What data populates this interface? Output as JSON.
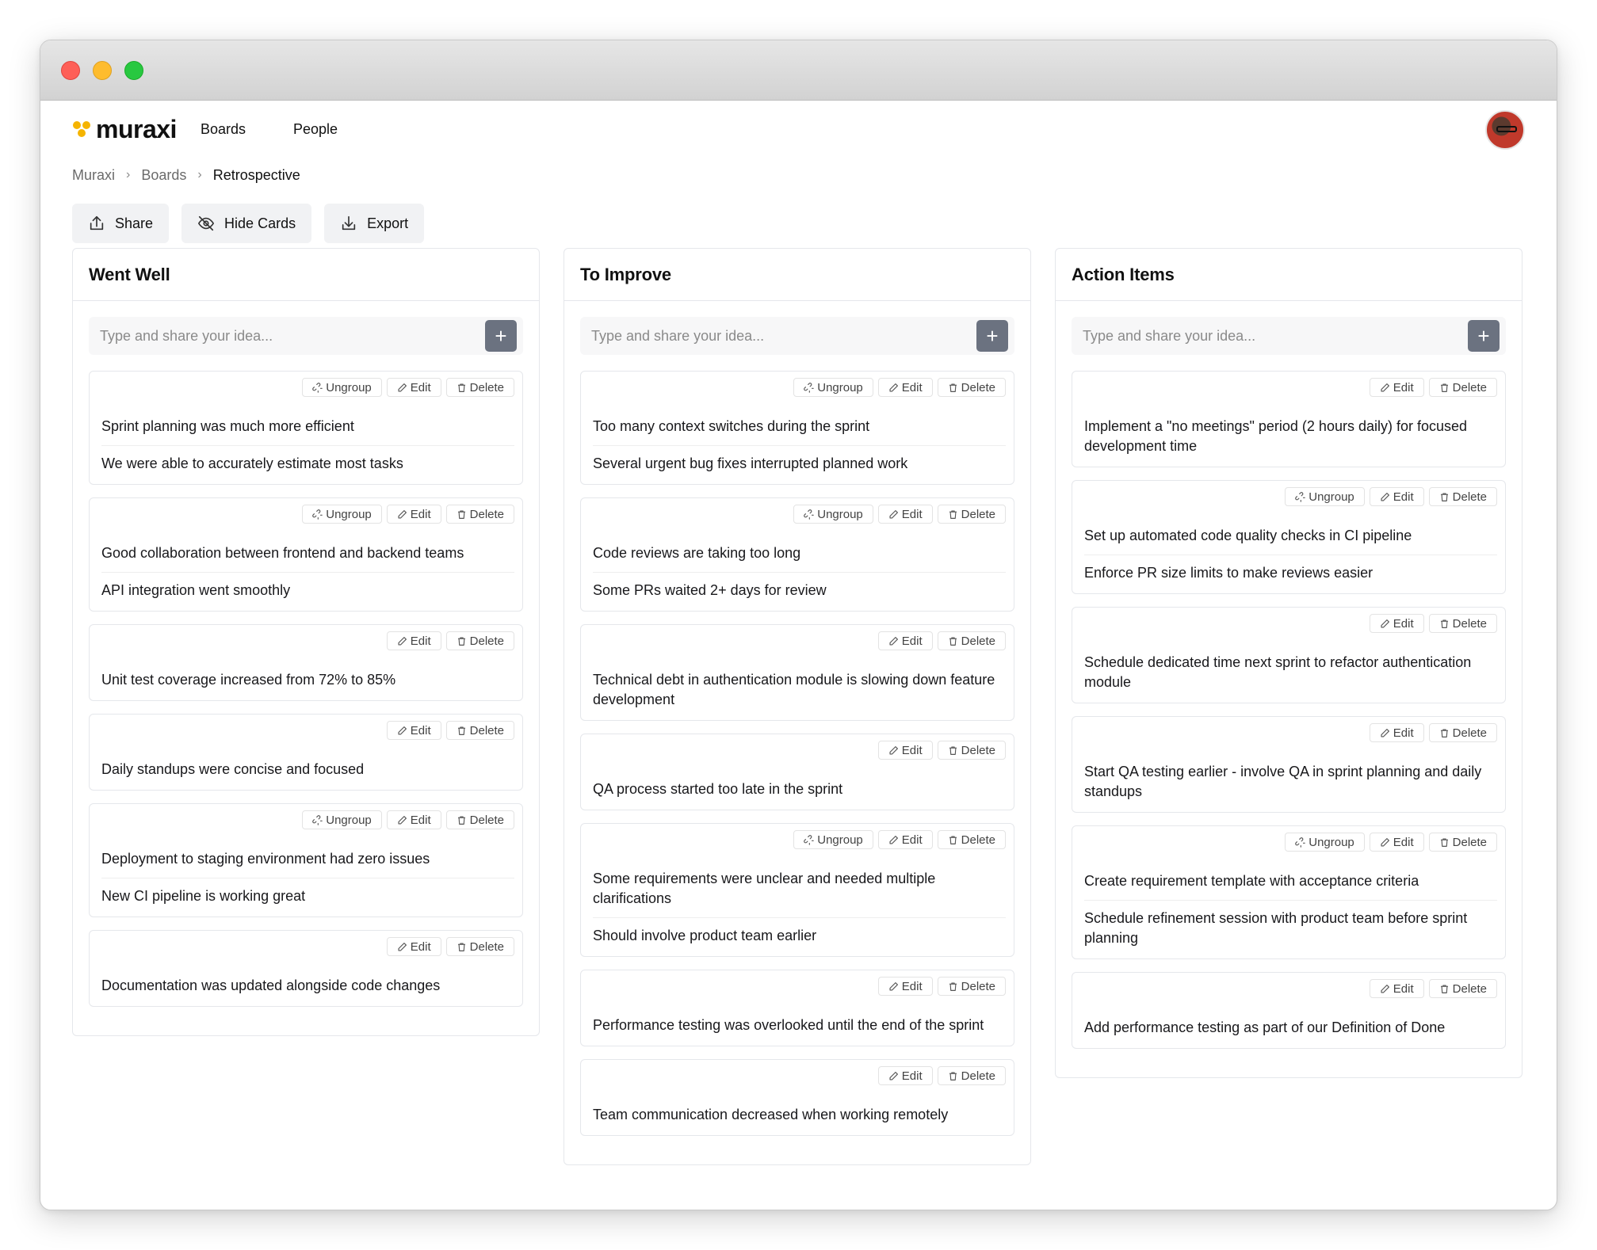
{
  "brand": {
    "name": "muraxi"
  },
  "nav": {
    "items": [
      "Boards",
      "People"
    ]
  },
  "breadcrumb": {
    "items": [
      "Muraxi",
      "Boards",
      "Retrospective"
    ]
  },
  "toolbar": {
    "share": "Share",
    "hide_cards": "Hide Cards",
    "export": "Export"
  },
  "idea_placeholder": "Type and share your idea...",
  "labels": {
    "ungroup": "Ungroup",
    "edit": "Edit",
    "delete": "Delete",
    "add": "+"
  },
  "columns": [
    {
      "title": "Went Well",
      "cards": [
        {
          "grouped": true,
          "items": [
            "Sprint planning was much more efficient",
            "We were able to accurately estimate most tasks"
          ]
        },
        {
          "grouped": true,
          "items": [
            "Good collaboration between frontend and backend teams",
            "API integration went smoothly"
          ]
        },
        {
          "grouped": false,
          "items": [
            "Unit test coverage increased from 72% to 85%"
          ]
        },
        {
          "grouped": false,
          "items": [
            "Daily standups were concise and focused"
          ]
        },
        {
          "grouped": true,
          "items": [
            "Deployment to staging environment had zero issues",
            "New CI pipeline is working great"
          ]
        },
        {
          "grouped": false,
          "items": [
            "Documentation was updated alongside code changes"
          ]
        }
      ]
    },
    {
      "title": "To Improve",
      "cards": [
        {
          "grouped": true,
          "items": [
            "Too many context switches during the sprint",
            "Several urgent bug fixes interrupted planned work"
          ]
        },
        {
          "grouped": true,
          "items": [
            "Code reviews are taking too long",
            "Some PRs waited 2+ days for review"
          ]
        },
        {
          "grouped": false,
          "items": [
            "Technical debt in authentication module is slowing down feature development"
          ]
        },
        {
          "grouped": false,
          "items": [
            "QA process started too late in the sprint"
          ]
        },
        {
          "grouped": true,
          "items": [
            "Some requirements were unclear and needed multiple clarifications",
            "Should involve product team earlier"
          ]
        },
        {
          "grouped": false,
          "items": [
            "Performance testing was overlooked until the end of the sprint"
          ]
        },
        {
          "grouped": false,
          "items": [
            "Team communication decreased when working remotely"
          ]
        }
      ]
    },
    {
      "title": "Action Items",
      "cards": [
        {
          "grouped": false,
          "items": [
            "Implement a \"no meetings\" period (2 hours daily) for focused development time"
          ]
        },
        {
          "grouped": true,
          "items": [
            "Set up automated code quality checks in CI pipeline",
            "Enforce PR size limits to make reviews easier"
          ]
        },
        {
          "grouped": false,
          "items": [
            "Schedule dedicated time next sprint to refactor authentication module"
          ]
        },
        {
          "grouped": false,
          "items": [
            "Start QA testing earlier - involve QA in sprint planning and daily standups"
          ]
        },
        {
          "grouped": true,
          "items": [
            "Create requirement template with acceptance criteria",
            "Schedule refinement session with product team before sprint planning"
          ]
        },
        {
          "grouped": false,
          "items": [
            "Add performance testing as part of our Definition of Done"
          ]
        }
      ]
    }
  ]
}
